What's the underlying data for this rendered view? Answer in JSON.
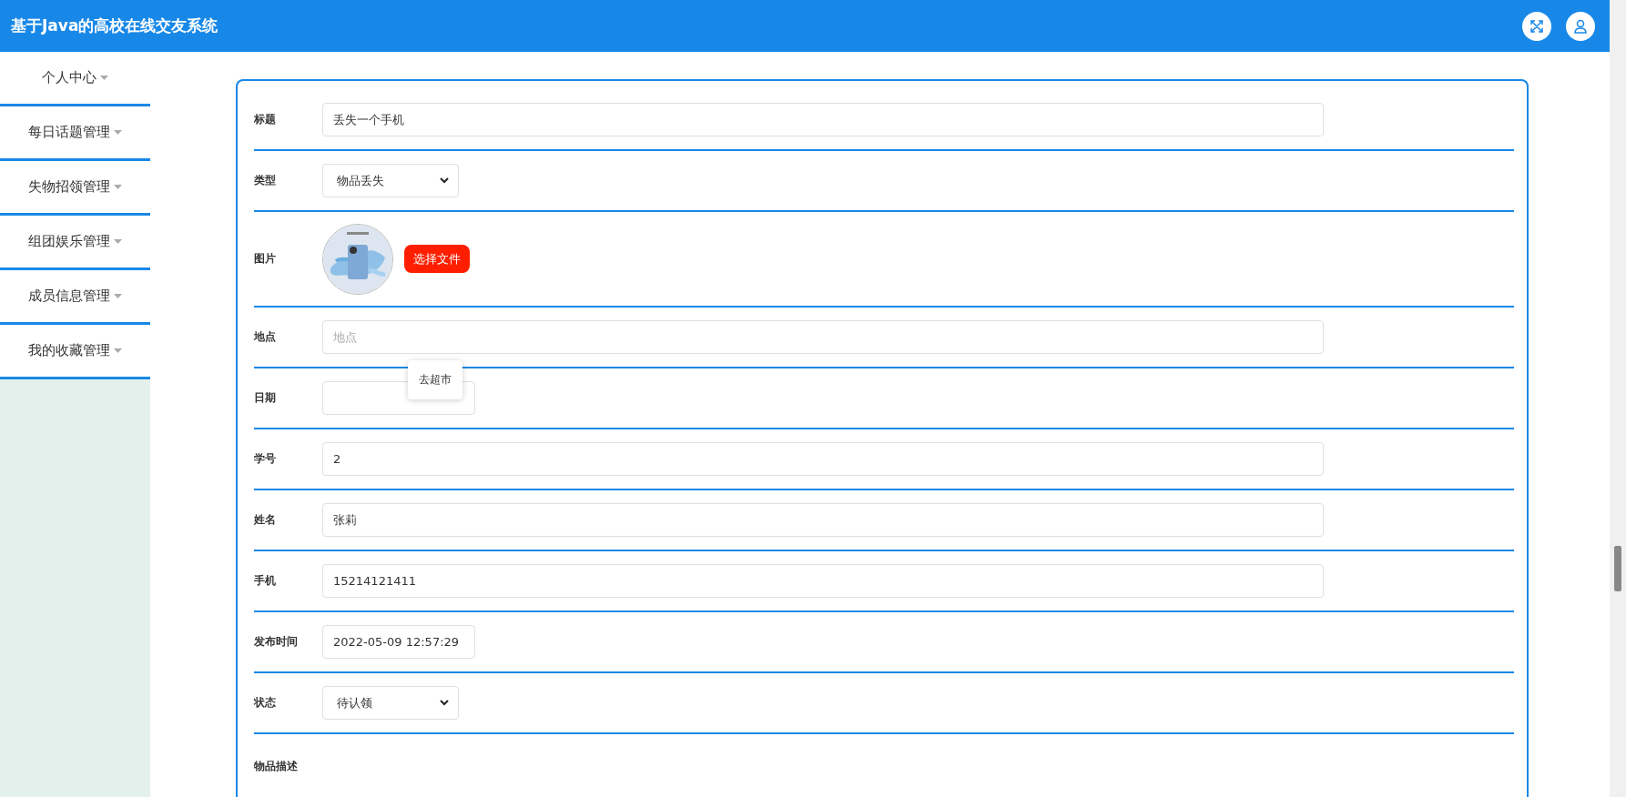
{
  "header": {
    "title": "基于Java的高校在线交友系统"
  },
  "sidebar": {
    "items": [
      {
        "label": "个人中心"
      },
      {
        "label": "每日话题管理"
      },
      {
        "label": "失物招领管理"
      },
      {
        "label": "组团娱乐管理"
      },
      {
        "label": "成员信息管理"
      },
      {
        "label": "我的收藏管理"
      }
    ]
  },
  "form": {
    "fields": [
      {
        "kind": "text",
        "label": "标题",
        "value": "丢失一个手机"
      },
      {
        "kind": "select",
        "label": "类型",
        "value": "物品丢失"
      },
      {
        "label": "图片",
        "button": "选择文件"
      },
      {
        "kind": "text",
        "label": "地点",
        "placeholder": "地点",
        "suggestion": "去超市"
      },
      {
        "kind": "date",
        "label": "日期"
      },
      {
        "kind": "text",
        "label": "学号",
        "value": "2"
      },
      {
        "kind": "text",
        "label": "姓名",
        "value": "张莉"
      },
      {
        "kind": "text",
        "label": "手机",
        "value": "15214121411"
      },
      {
        "kind": "date",
        "label": "发布时间",
        "value": "2022-05-09 12:57:29"
      },
      {
        "kind": "select",
        "label": "状态",
        "value": "待认领"
      },
      {
        "kind": "editor",
        "label": "物品描述"
      }
    ]
  }
}
